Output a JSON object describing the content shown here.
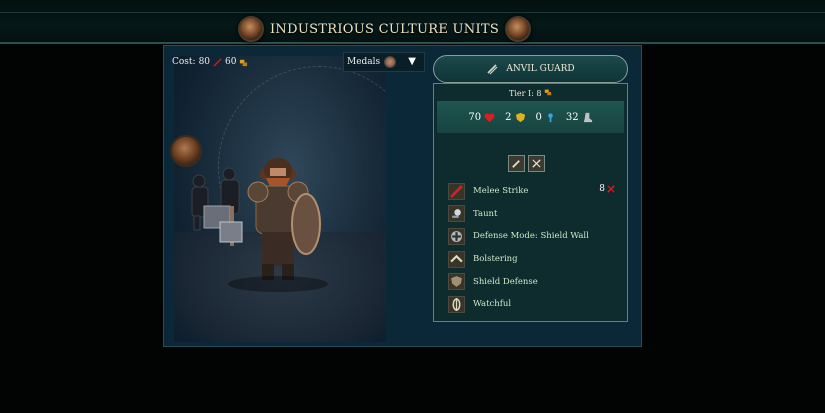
{
  "header": {
    "title": "INDUSTRIOUS CULTURE UNITS"
  },
  "unit_panel": {
    "cost_label": "Cost:",
    "cost_value": "80",
    "gold_value": "60",
    "medals_dropdown": {
      "selected": "Medals"
    }
  },
  "card": {
    "name": "ANVIL GUARD",
    "tier": "Tier I: 8",
    "stats": {
      "health": "70",
      "armor": "2",
      "magic": "0",
      "movement": "32"
    },
    "abilities": [
      {
        "label": "Melee Strike",
        "icon": "melee-strike-icon",
        "damage": "8"
      },
      {
        "label": "Taunt",
        "icon": "taunt-icon"
      },
      {
        "label": "Defense Mode: Shield Wall",
        "icon": "shield-wall-icon"
      },
      {
        "label": "Bolstering",
        "icon": "bolstering-icon"
      },
      {
        "label": "Shield Defense",
        "icon": "shield-defense-icon"
      },
      {
        "label": "Watchful",
        "icon": "watchful-icon"
      }
    ]
  },
  "colors": {
    "panel_bg": "#0b2838",
    "card_header": "#1b4a4c",
    "ability_text": "#cfe8c8",
    "health": "#d82020",
    "gold": "#e0a020"
  }
}
